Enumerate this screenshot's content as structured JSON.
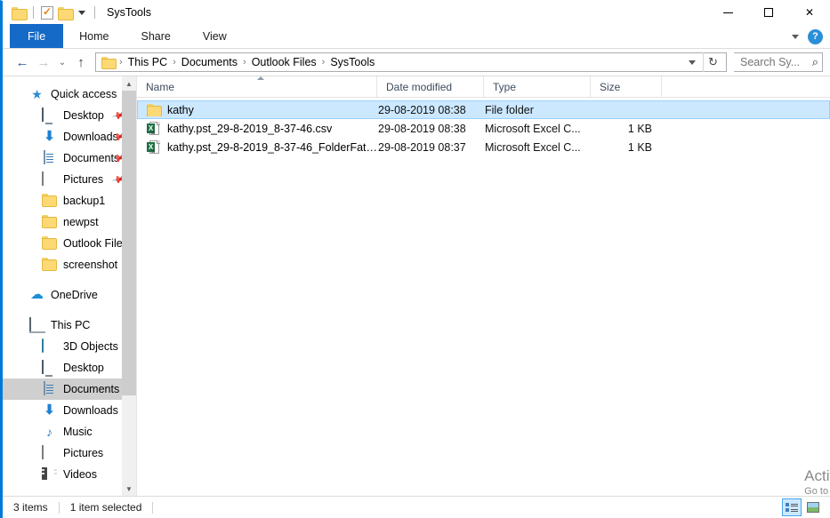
{
  "window": {
    "title": "SysTools",
    "quick_access_toolbar": [
      {
        "name": "folder-icon",
        "label": ""
      },
      {
        "name": "properties-icon",
        "label": ""
      },
      {
        "name": "new-folder-icon",
        "label": ""
      },
      {
        "name": "customize-caret-icon",
        "label": ""
      }
    ],
    "controls": {
      "minimize": "–",
      "maximize": "□",
      "close": "✕"
    }
  },
  "ribbon": {
    "tabs": [
      {
        "label": "File",
        "active": true
      },
      {
        "label": "Home",
        "active": false
      },
      {
        "label": "Share",
        "active": false
      },
      {
        "label": "View",
        "active": false
      }
    ],
    "expand_label": "",
    "help_label": "?"
  },
  "address_bar": {
    "back_label": "←",
    "forward_label": "→",
    "recent_label": "⌄",
    "up_label": "↑",
    "breadcrumbs": [
      "This PC",
      "Documents",
      "Outlook Files",
      "SysTools"
    ],
    "separator": "›",
    "refresh_label": "↻",
    "dropdown_label": ""
  },
  "search": {
    "value": "",
    "placeholder": "Search Sy...",
    "icon": "⌕"
  },
  "sidebar": {
    "groups": [
      {
        "name": "quick-access",
        "items": [
          {
            "label": "Quick access",
            "icon": "star-icon",
            "level": 0,
            "pinned": false,
            "selected": false
          },
          {
            "label": "Desktop",
            "icon": "monitor-icon",
            "level": 1,
            "pinned": true,
            "selected": false
          },
          {
            "label": "Downloads",
            "icon": "download-icon",
            "level": 1,
            "pinned": true,
            "selected": false
          },
          {
            "label": "Documents",
            "icon": "document-icon",
            "level": 1,
            "pinned": true,
            "selected": false
          },
          {
            "label": "Pictures",
            "icon": "picture-icon",
            "level": 1,
            "pinned": true,
            "selected": false
          },
          {
            "label": "backup1",
            "icon": "folder-icon",
            "level": 1,
            "pinned": false,
            "selected": false
          },
          {
            "label": "newpst",
            "icon": "folder-icon",
            "level": 1,
            "pinned": false,
            "selected": false
          },
          {
            "label": "Outlook Files",
            "icon": "folder-icon",
            "level": 1,
            "pinned": false,
            "selected": false
          },
          {
            "label": "screenshot",
            "icon": "folder-icon",
            "level": 1,
            "pinned": false,
            "selected": false
          }
        ]
      },
      {
        "name": "onedrive",
        "items": [
          {
            "label": "OneDrive",
            "icon": "cloud-icon",
            "level": 0,
            "pinned": false,
            "selected": false
          }
        ]
      },
      {
        "name": "this-pc",
        "items": [
          {
            "label": "This PC",
            "icon": "pc-icon",
            "level": 0,
            "pinned": false,
            "selected": false
          },
          {
            "label": "3D Objects",
            "icon": "3d-objects-icon",
            "level": 1,
            "pinned": false,
            "selected": false
          },
          {
            "label": "Desktop",
            "icon": "monitor-icon",
            "level": 1,
            "pinned": false,
            "selected": false
          },
          {
            "label": "Documents",
            "icon": "document-icon",
            "level": 1,
            "pinned": false,
            "selected": true
          },
          {
            "label": "Downloads",
            "icon": "download-icon",
            "level": 1,
            "pinned": false,
            "selected": false
          },
          {
            "label": "Music",
            "icon": "music-icon",
            "level": 1,
            "pinned": false,
            "selected": false
          },
          {
            "label": "Pictures",
            "icon": "picture-icon",
            "level": 1,
            "pinned": false,
            "selected": false
          },
          {
            "label": "Videos",
            "icon": "video-icon",
            "level": 1,
            "pinned": false,
            "selected": false
          }
        ]
      }
    ],
    "scrollbar": {
      "up": "▲",
      "down": "▼"
    }
  },
  "file_list": {
    "columns": [
      {
        "label": "Name",
        "sorted": true,
        "sort_direction": "asc"
      },
      {
        "label": "Date modified",
        "sorted": false,
        "sort_direction": ""
      },
      {
        "label": "Type",
        "sorted": false,
        "sort_direction": ""
      },
      {
        "label": "Size",
        "sorted": false,
        "sort_direction": ""
      }
    ],
    "rows": [
      {
        "name": "kathy",
        "date_modified": "29-08-2019 08:38",
        "type": "File folder",
        "size": "",
        "icon": "folder-icon",
        "selected": true
      },
      {
        "name": "kathy.pst_29-8-2019_8-37-46.csv",
        "date_modified": "29-08-2019 08:38",
        "type": "Microsoft Excel C...",
        "size": "1 KB",
        "icon": "csv-file-icon",
        "selected": false
      },
      {
        "name": "kathy.pst_29-8-2019_8-37-46_FolderFath...",
        "date_modified": "29-08-2019 08:37",
        "type": "Microsoft Excel C...",
        "size": "1 KB",
        "icon": "csv-file-icon",
        "selected": false
      }
    ]
  },
  "status_bar": {
    "item_count": "3 items",
    "selection": "1 item selected",
    "view_details_label": "",
    "view_icons_label": ""
  },
  "watermark": {
    "line1": "Activ",
    "line2": "Go to"
  },
  "colors": {
    "accent": "#0078d7",
    "file_tab": "#1569c7",
    "selection": "#cce8ff",
    "selection_border": "#99d1ff",
    "nav_selected": "#cfcfcf",
    "folder_yellow": "#fcd975",
    "excel_green": "#1d7045"
  }
}
